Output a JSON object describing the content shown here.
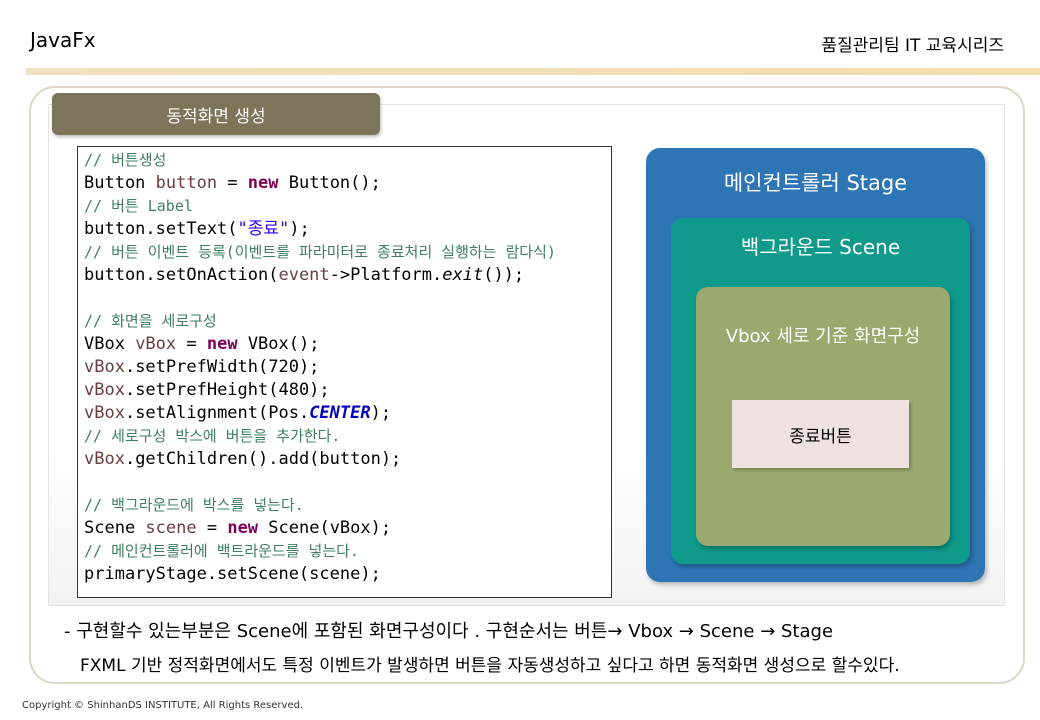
{
  "header": {
    "left_title": "JavaFx",
    "right_title": "품질관리팀 IT 교육시리즈"
  },
  "section": {
    "title": "동적화면 생성"
  },
  "code": {
    "c1": "// 버튼생성",
    "l1a": "Button ",
    "l1b": "button",
    "l1c": " = ",
    "l1d": "new",
    "l1e": " Button();",
    "c2": "// 버튼 Label",
    "l2a": "button.setText(",
    "l2b": "\"종료\"",
    "l2c": ");",
    "c3": "// 버튼 이벤트 등록(이벤트를 파라미터로 종료처리 실행하는 람다식)",
    "l3a": "button.setOnAction(",
    "l3b": "event",
    "l3c": "->Platform.",
    "l3d": "exit",
    "l3e": "());",
    "c4": "// 화면을 세로구성",
    "l4a": "VBox ",
    "l4b": "vBox",
    "l4c": " = ",
    "l4d": "new",
    "l4e": " VBox();",
    "l5a": "vBox",
    "l5b": ".setPrefWidth(720);",
    "l6a": "vBox",
    "l6b": ".setPrefHeight(480);",
    "l7a": "vBox",
    "l7b": ".setAlignment(Pos.",
    "l7c": "CENTER",
    "l7d": ");",
    "c5": "// 세로구성 박스에 버튼을 추가한다.",
    "l8a": "vBox",
    "l8b": ".getChildren().add(button);",
    "c6": "// 백그라운드에 박스를 넣는다.",
    "l9a": "Scene ",
    "l9b": "scene",
    "l9c": " = ",
    "l9d": "new",
    "l9e": " Scene(vBox);",
    "c7": "// 메인컨트롤러에 백트라운드를 넣는다.",
    "l10": "primaryStage.setScene(scene);"
  },
  "diagram": {
    "stage_label": "메인컨트롤러 Stage",
    "scene_label": "백그라운드 Scene",
    "vbox_label": "Vbox 세로 기준 화면구성",
    "button_label": "종료버튼"
  },
  "notes": {
    "line1": "- 구현할수 있는부분은 Scene에 포함된 화면구성이다 . 구현순서는 버튼→ Vbox → Scene → Stage",
    "line2": "FXML 기반 정적화면에서도 특정 이벤트가 발생하면 버튼을 자동생성하고 싶다고 하면 동적화면 생성으로 할수있다."
  },
  "footer": {
    "copyright": "Copyright © ShinhanDS INSTITUTE, All Rights Reserved."
  },
  "colors": {
    "stage": "#2e75b6",
    "scene": "#0f9a8c",
    "vbox": "#9aaa6e",
    "button": "#f1e2e2",
    "section_tab": "#7d7459",
    "header_bar": "#f2dcab"
  }
}
